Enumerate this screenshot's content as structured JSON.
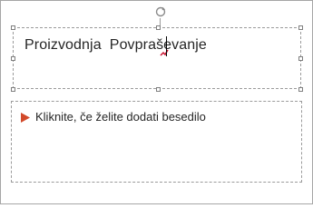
{
  "slide": {
    "title_text": "Proizvodnja  Povpraševanje",
    "body_placeholder": "Kliknite, če želite dodati besedilo"
  },
  "icons": {
    "rotate": "rotate-handle-icon",
    "bullet": "triangle-bullet-icon"
  },
  "colors": {
    "bullet": "#d2492a",
    "text": "#262626",
    "border": "#9b9b9b"
  }
}
